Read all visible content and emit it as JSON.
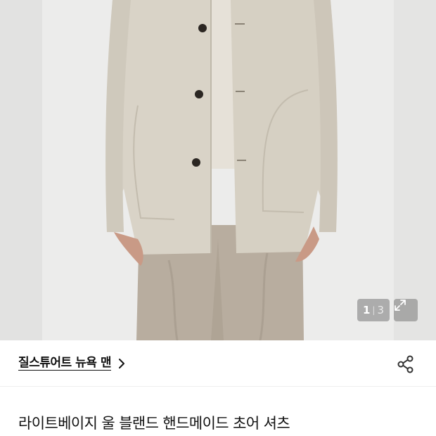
{
  "product": {
    "image_counter": {
      "current": "1",
      "separator": "|",
      "total": "3"
    },
    "brand": {
      "name": "질스튜어트 뉴욕 맨"
    },
    "title": "라이트베이지 울 블랜드 핸드메이드 초어 셔츠"
  },
  "icons": {
    "expand": "expand-icon",
    "chevron": "chevron-right-icon",
    "share": "share-icon"
  },
  "colors": {
    "background": "#ffffff",
    "text": "#111111",
    "overlay": "#787878",
    "coat": "#d7d1c5",
    "trousers": "#b6ab9c"
  }
}
